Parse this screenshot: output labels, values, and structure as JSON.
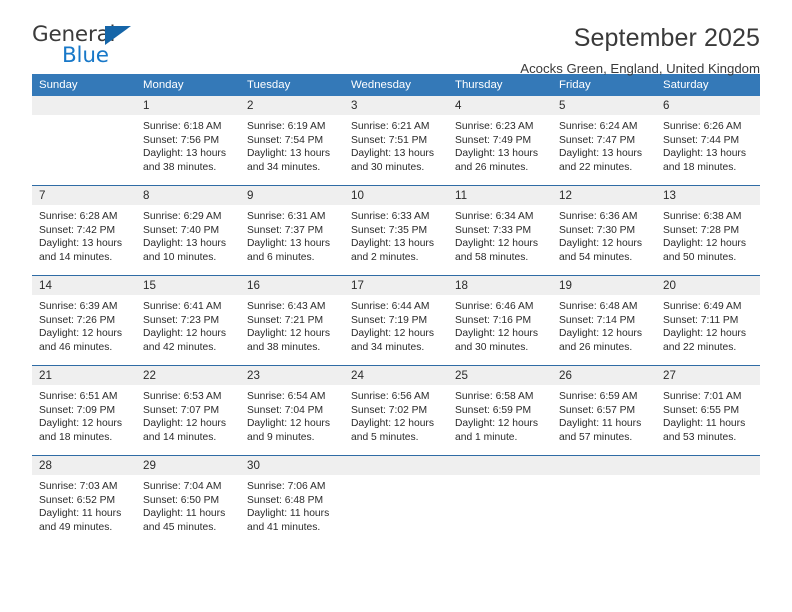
{
  "logo": {
    "word_top": "General",
    "word_bottom": "Blue",
    "accent_color": "#1878c8",
    "flag_color": "#1565a8"
  },
  "header": {
    "title": "September 2025",
    "subtitle": "Acocks Green, England, United Kingdom"
  },
  "theme": {
    "header_bg": "#3479b8",
    "daynum_bg": "#efefef",
    "row_divider": "#2f6ca5"
  },
  "weekdays": [
    "Sunday",
    "Monday",
    "Tuesday",
    "Wednesday",
    "Thursday",
    "Friday",
    "Saturday"
  ],
  "weeks": [
    [
      {
        "day": "",
        "lines": []
      },
      {
        "day": "1",
        "lines": [
          "Sunrise: 6:18 AM",
          "Sunset: 7:56 PM",
          "Daylight: 13 hours",
          "and 38 minutes."
        ]
      },
      {
        "day": "2",
        "lines": [
          "Sunrise: 6:19 AM",
          "Sunset: 7:54 PM",
          "Daylight: 13 hours",
          "and 34 minutes."
        ]
      },
      {
        "day": "3",
        "lines": [
          "Sunrise: 6:21 AM",
          "Sunset: 7:51 PM",
          "Daylight: 13 hours",
          "and 30 minutes."
        ]
      },
      {
        "day": "4",
        "lines": [
          "Sunrise: 6:23 AM",
          "Sunset: 7:49 PM",
          "Daylight: 13 hours",
          "and 26 minutes."
        ]
      },
      {
        "day": "5",
        "lines": [
          "Sunrise: 6:24 AM",
          "Sunset: 7:47 PM",
          "Daylight: 13 hours",
          "and 22 minutes."
        ]
      },
      {
        "day": "6",
        "lines": [
          "Sunrise: 6:26 AM",
          "Sunset: 7:44 PM",
          "Daylight: 13 hours",
          "and 18 minutes."
        ]
      }
    ],
    [
      {
        "day": "7",
        "lines": [
          "Sunrise: 6:28 AM",
          "Sunset: 7:42 PM",
          "Daylight: 13 hours",
          "and 14 minutes."
        ]
      },
      {
        "day": "8",
        "lines": [
          "Sunrise: 6:29 AM",
          "Sunset: 7:40 PM",
          "Daylight: 13 hours",
          "and 10 minutes."
        ]
      },
      {
        "day": "9",
        "lines": [
          "Sunrise: 6:31 AM",
          "Sunset: 7:37 PM",
          "Daylight: 13 hours",
          "and 6 minutes."
        ]
      },
      {
        "day": "10",
        "lines": [
          "Sunrise: 6:33 AM",
          "Sunset: 7:35 PM",
          "Daylight: 13 hours",
          "and 2 minutes."
        ]
      },
      {
        "day": "11",
        "lines": [
          "Sunrise: 6:34 AM",
          "Sunset: 7:33 PM",
          "Daylight: 12 hours",
          "and 58 minutes."
        ]
      },
      {
        "day": "12",
        "lines": [
          "Sunrise: 6:36 AM",
          "Sunset: 7:30 PM",
          "Daylight: 12 hours",
          "and 54 minutes."
        ]
      },
      {
        "day": "13",
        "lines": [
          "Sunrise: 6:38 AM",
          "Sunset: 7:28 PM",
          "Daylight: 12 hours",
          "and 50 minutes."
        ]
      }
    ],
    [
      {
        "day": "14",
        "lines": [
          "Sunrise: 6:39 AM",
          "Sunset: 7:26 PM",
          "Daylight: 12 hours",
          "and 46 minutes."
        ]
      },
      {
        "day": "15",
        "lines": [
          "Sunrise: 6:41 AM",
          "Sunset: 7:23 PM",
          "Daylight: 12 hours",
          "and 42 minutes."
        ]
      },
      {
        "day": "16",
        "lines": [
          "Sunrise: 6:43 AM",
          "Sunset: 7:21 PM",
          "Daylight: 12 hours",
          "and 38 minutes."
        ]
      },
      {
        "day": "17",
        "lines": [
          "Sunrise: 6:44 AM",
          "Sunset: 7:19 PM",
          "Daylight: 12 hours",
          "and 34 minutes."
        ]
      },
      {
        "day": "18",
        "lines": [
          "Sunrise: 6:46 AM",
          "Sunset: 7:16 PM",
          "Daylight: 12 hours",
          "and 30 minutes."
        ]
      },
      {
        "day": "19",
        "lines": [
          "Sunrise: 6:48 AM",
          "Sunset: 7:14 PM",
          "Daylight: 12 hours",
          "and 26 minutes."
        ]
      },
      {
        "day": "20",
        "lines": [
          "Sunrise: 6:49 AM",
          "Sunset: 7:11 PM",
          "Daylight: 12 hours",
          "and 22 minutes."
        ]
      }
    ],
    [
      {
        "day": "21",
        "lines": [
          "Sunrise: 6:51 AM",
          "Sunset: 7:09 PM",
          "Daylight: 12 hours",
          "and 18 minutes."
        ]
      },
      {
        "day": "22",
        "lines": [
          "Sunrise: 6:53 AM",
          "Sunset: 7:07 PM",
          "Daylight: 12 hours",
          "and 14 minutes."
        ]
      },
      {
        "day": "23",
        "lines": [
          "Sunrise: 6:54 AM",
          "Sunset: 7:04 PM",
          "Daylight: 12 hours",
          "and 9 minutes."
        ]
      },
      {
        "day": "24",
        "lines": [
          "Sunrise: 6:56 AM",
          "Sunset: 7:02 PM",
          "Daylight: 12 hours",
          "and 5 minutes."
        ]
      },
      {
        "day": "25",
        "lines": [
          "Sunrise: 6:58 AM",
          "Sunset: 6:59 PM",
          "Daylight: 12 hours",
          "and 1 minute."
        ]
      },
      {
        "day": "26",
        "lines": [
          "Sunrise: 6:59 AM",
          "Sunset: 6:57 PM",
          "Daylight: 11 hours",
          "and 57 minutes."
        ]
      },
      {
        "day": "27",
        "lines": [
          "Sunrise: 7:01 AM",
          "Sunset: 6:55 PM",
          "Daylight: 11 hours",
          "and 53 minutes."
        ]
      }
    ],
    [
      {
        "day": "28",
        "lines": [
          "Sunrise: 7:03 AM",
          "Sunset: 6:52 PM",
          "Daylight: 11 hours",
          "and 49 minutes."
        ]
      },
      {
        "day": "29",
        "lines": [
          "Sunrise: 7:04 AM",
          "Sunset: 6:50 PM",
          "Daylight: 11 hours",
          "and 45 minutes."
        ]
      },
      {
        "day": "30",
        "lines": [
          "Sunrise: 7:06 AM",
          "Sunset: 6:48 PM",
          "Daylight: 11 hours",
          "and 41 minutes."
        ]
      },
      {
        "day": "",
        "lines": []
      },
      {
        "day": "",
        "lines": []
      },
      {
        "day": "",
        "lines": []
      },
      {
        "day": "",
        "lines": []
      }
    ]
  ]
}
